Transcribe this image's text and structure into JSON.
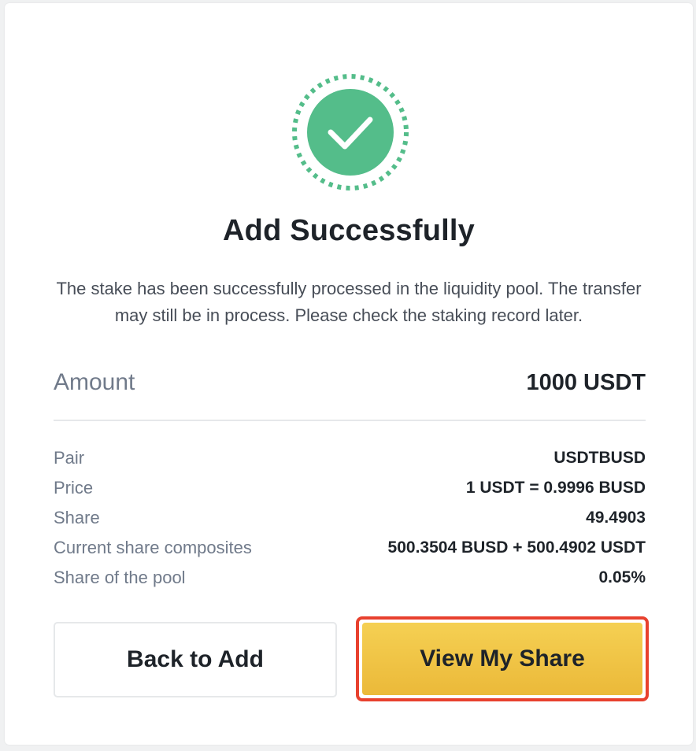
{
  "status": {
    "icon": "check-circle-icon",
    "color": "#54bd8a",
    "title": "Add Successfully",
    "description": "The stake has been successfully processed in the liquidity pool. The transfer may still be in process. Please check the staking record later."
  },
  "amount": {
    "label": "Amount",
    "value": "1000 USDT"
  },
  "details": [
    {
      "label": "Pair",
      "value": "USDTBUSD"
    },
    {
      "label": "Price",
      "value": "1 USDT = 0.9996 BUSD"
    },
    {
      "label": "Share",
      "value": "49.4903"
    },
    {
      "label": "Current share composites",
      "value": "500.3504 BUSD + 500.4902 USDT"
    },
    {
      "label": "Share of the pool",
      "value": "0.05%"
    }
  ],
  "buttons": {
    "back_label": "Back to Add",
    "view_label": "View My Share"
  },
  "colors": {
    "primary_button": "#f0c844",
    "highlight_border": "#e8412e",
    "success": "#54bd8a"
  }
}
